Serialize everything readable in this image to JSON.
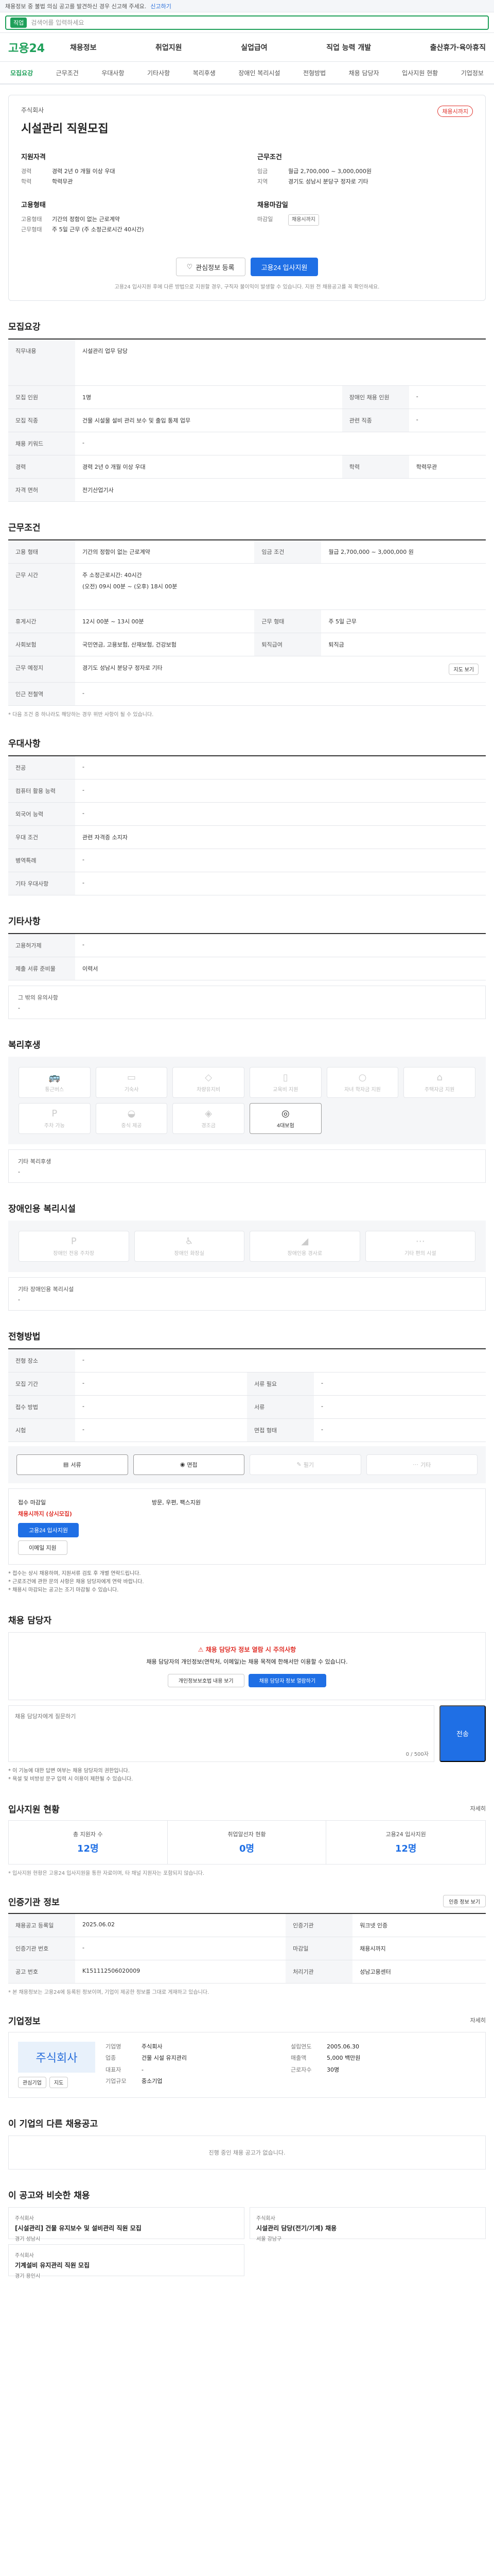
{
  "topbar": {
    "notice": "채용정보 중 불법 의심 공고를 발견하신 경우 신고해 주세요.",
    "report": "신고하기"
  },
  "search": {
    "tag": "직업",
    "placeholder": "검색어를 입력하세요"
  },
  "gnb": {
    "logo": "고용24",
    "menu": [
      "채용정보",
      "취업지원",
      "실업급여",
      "직업 능력 개발",
      "출산휴가·육아휴직"
    ]
  },
  "subnav": {
    "items": [
      "모집요강",
      "근무조건",
      "우대사항",
      "기타사항",
      "복리후생",
      "장애인 복리시설",
      "전형방법",
      "채용 담당자",
      "입사지원 현황",
      "기업정보"
    ]
  },
  "summary": {
    "company": "주식회사",
    "title": "시설관리 직원모집",
    "badge": "채용시까지",
    "qual_title": "지원자격",
    "qual_rows": [
      {
        "k": "경력",
        "v": "경력 2년 0 개월 이상 우대"
      },
      {
        "k": "학력",
        "v": "학력무관"
      }
    ],
    "cond_title": "근무조건",
    "cond_rows": [
      {
        "k": "임금",
        "v": "월급 2,700,000 ~ 3,000,000원"
      },
      {
        "k": "지역",
        "v": "경기도 성남시 분당구 정자로 기타"
      }
    ],
    "form_title": "고용형태",
    "form_rows": [
      {
        "k": "고용형태",
        "v": "기간의 정함이 없는 근로계약"
      },
      {
        "k": "근무형태",
        "v": "주 5일 근무 (주 소정근로시간 40시간)"
      }
    ],
    "close_title": "채용마감일",
    "close_rows": [
      {
        "k": "마감일",
        "v": "채용시까지"
      }
    ],
    "btn_interest": "관심정보 등록",
    "btn_apply": "고용24 입사지원",
    "note": "고용24 입사지원 후에 다른 방법으로 지원할 경우, 구직자 불이익이 발생할 수 있습니다. 지원 전 채용공고를 꼭 확인하세요."
  },
  "recruit": {
    "title": "모집요강",
    "rows": [
      {
        "k": "직무내용",
        "v": "시설관리 업무 담당"
      },
      {
        "k": "모집 인원",
        "v": "1명"
      },
      {
        "k": "모집 직종",
        "v": "건물 시설물 설비 관리 보수 및 출입 통제 업무"
      },
      {
        "k": "채용 키워드",
        "v": "-"
      },
      {
        "k": "경력",
        "v": "경력 2년 0 개월 이상 우대"
      },
      {
        "k": "자격 면허",
        "v": "전기산업기사"
      }
    ],
    "rows_right": [
      {
        "k": "장애인 채용 인원",
        "v": "-"
      },
      {
        "k": "관련 직종",
        "v": "-"
      },
      {
        "k": "학력",
        "v": "학력무관"
      }
    ]
  },
  "work": {
    "title": "근무조건",
    "rows": [
      {
        "k": "고용 형태",
        "v": "기간의 정함이 없는 근로계약"
      },
      {
        "k": "근무 예정지",
        "v": "주 소정근로시간: 40시간"
      },
      {
        "k": "근무 시간",
        "v": "(오전) 09시 00분 ~ (오후) 18시 00분"
      },
      {
        "k": "휴게시간",
        "v": "12시 00분 ~ 13시 00분"
      },
      {
        "k": "사회보험",
        "v": "국민연금, 고용보험, 산재보험, 건강보험"
      },
      {
        "k": "근무 예정지",
        "v": "경기도 성남시 분당구 정자로 기타"
      },
      {
        "k": "인근 전철역",
        "v": "-"
      }
    ],
    "pay": "월급 2,700,000 ~ 3,000,000 원",
    "work_form": "주 5일 근무",
    "severance": "퇴직금",
    "map_btn": "지도 보기",
    "note": "* 다음 조건 중 하나라도 해당하는 경우 위반 사항이 될 수 있습니다."
  },
  "prefer": {
    "title": "우대사항",
    "rows": [
      {
        "k": "전공",
        "v": "-"
      },
      {
        "k": "컴퓨터 활용 능력",
        "v": "-"
      },
      {
        "k": "외국어 능력",
        "v": "-"
      },
      {
        "k": "우대 조건",
        "v": "관련 자격증 소지자"
      },
      {
        "k": "병역특례",
        "v": "-"
      },
      {
        "k": "기타 우대사항",
        "v": "-"
      }
    ]
  },
  "etc": {
    "title": "기타사항",
    "rows": [
      {
        "k": "고용허가제",
        "v": "-"
      },
      {
        "k": "제출 서류 준비물",
        "v": "이력서"
      }
    ],
    "extra_label": "그 밖의 유의사항",
    "extra_value": "-"
  },
  "welfare": {
    "title": "복리후생",
    "items": [
      {
        "icon": "house-icon",
        "label": "통근버스",
        "on": false
      },
      {
        "icon": "bed-icon",
        "label": "기숙사",
        "on": false
      },
      {
        "icon": "cup-icon",
        "label": "차량유지비",
        "on": false
      },
      {
        "icon": "book-icon",
        "label": "교육비 지원",
        "on": false
      },
      {
        "icon": "child-icon",
        "label": "자녀 학자금 지원",
        "on": false
      },
      {
        "icon": "home-icon",
        "label": "주택자금 지원",
        "on": false
      },
      {
        "icon": "car-icon",
        "label": "주차 가능",
        "on": false
      },
      {
        "icon": "meal-icon",
        "label": "중식 제공",
        "on": false
      },
      {
        "icon": "gift-icon",
        "label": "경조금",
        "on": false
      },
      {
        "icon": "coin-icon",
        "label": "4대보험",
        "on": true
      }
    ],
    "extra_label": "기타 복리후생",
    "extra_value": "-"
  },
  "disability": {
    "title": "장애인용 복리시설",
    "items": [
      "장애인 전용 주차장",
      "장애인 화장실",
      "장애인용 경사로",
      "기타 편의 시설"
    ],
    "extra_label": "기타 장애인용 복리시설",
    "extra_value": "-"
  },
  "process": {
    "title": "전형방법",
    "rows": [
      {
        "k": "전형 장소",
        "v": "-"
      },
      {
        "k": "모집 기간",
        "v": "-"
      },
      {
        "k": "접수 방법",
        "v": "-"
      },
      {
        "k": "시험",
        "v": "-"
      }
    ],
    "rows_right": [
      {
        "k": "서류 필요",
        "v": "-"
      },
      {
        "k": "서류",
        "v": "-"
      },
      {
        "k": "면접 형태",
        "v": "-"
      }
    ],
    "methods": [
      {
        "label": "서류",
        "on": true
      },
      {
        "label": "면접",
        "on": true
      },
      {
        "label": "필기",
        "on": false
      },
      {
        "label": "기타",
        "on": false
      }
    ],
    "apply_left_title": "접수 마감일",
    "apply_left_red": "채용시까지 (상시모집)",
    "apply_btn": "고용24 입사지원",
    "apply_btn2": "이메일 지원",
    "apply_right": "방문, 우편, 팩스지원",
    "bullets": [
      "* 접수는 상시 채용하며, 지원서류 검토 후 개별 연락드립니다.",
      "* 근로조건에 관한 문의 사항은 채용 담당자에게 연락 바랍니다.",
      "* 채용시 마감되는 공고는 조기 마감될 수 있습니다."
    ]
  },
  "contact": {
    "title": "채용 담당자",
    "alert_title": "채용 담당자 정보 열람 시 주의사항",
    "alert_body": "채용 담당자의 개인정보(연락처, 이메일)는 채용 목적에 한해서만 이용할 수 있습니다.",
    "btn1": "개인정보보호법 내용 보기",
    "btn2": "채용 담당자 정보 열람하기",
    "qa_label": "채용 담당자에게 질문하기",
    "qa_count": "0 / 500자",
    "qa_btn": "전송",
    "bullets": [
      "* 이 기능에 대한 답변 여부는 채용 담당자의 권한입니다.",
      "* 욕설 및 비방성 문구 입력 시 이용이 제한될 수 있습니다."
    ]
  },
  "stats": {
    "title": "입사지원 현황",
    "more": "자세히",
    "items": [
      {
        "label": "총 지원자 수",
        "value": "12명"
      },
      {
        "label": "취업알선자 현황",
        "value": "0명"
      },
      {
        "label": "고용24 입사지원",
        "value": "12명"
      }
    ],
    "note": "* 입사지원 현황은 고용24 입사지원을 통한 자료이며, 타 채널 지원자는 포함되지 않습니다."
  },
  "registration": {
    "title": "인증기관 정보",
    "btn": "인증 정보 보기",
    "rows": [
      {
        "k": "채용공고 등록일",
        "v": "2025.06.02"
      },
      {
        "k": "인증기관 번호",
        "v": "-"
      },
      {
        "k": "공고 번호",
        "v": "K151112506020009"
      }
    ],
    "rows_right": [
      {
        "k": "인증기관",
        "v": "워크넷 인증"
      },
      {
        "k": "마감일",
        "v": "채용시까지"
      },
      {
        "k": "처리기관",
        "v": "성남고용센터"
      }
    ],
    "note": "* 본 채용정보는 고용24에 등록된 정보이며, 기업이 제공한 정보를 그대로 게재하고 있습니다."
  },
  "company": {
    "title": "기업정보",
    "more": "자세히",
    "logo": "주식회사",
    "btn_interest": "관심기업",
    "btn_map": "지도",
    "rows": [
      {
        "k": "기업명",
        "v": "주식회사"
      },
      {
        "k": "업종",
        "v": "건물 시설 유지관리"
      },
      {
        "k": "대표자",
        "v": "-"
      },
      {
        "k": "기업규모",
        "v": "중소기업"
      },
      {
        "k": "설립연도",
        "v": "2005.06.30"
      },
      {
        "k": "매출액",
        "v": "5,000 백만원"
      },
      {
        "k": "근로자수",
        "v": "30명"
      }
    ]
  },
  "other_jobs": {
    "title": "이 기업의 다른 채용공고",
    "empty": "진행 중인 채용 공고가 없습니다."
  },
  "recommend": {
    "title": "이 공고와 비슷한 채용",
    "items": [
      {
        "tag": "주식회사",
        "title": "[시설관리] 건물 유지보수 및 설비관리 직원 모집",
        "meta": "경기 성남시"
      },
      {
        "tag": "주식회사",
        "title": "시설관리 담당(전기/기계) 채용",
        "meta": "서울 강남구"
      },
      {
        "tag": "주식회사",
        "title": "기계설비 유지관리 직원 모집",
        "meta": "경기 용인시"
      }
    ]
  }
}
